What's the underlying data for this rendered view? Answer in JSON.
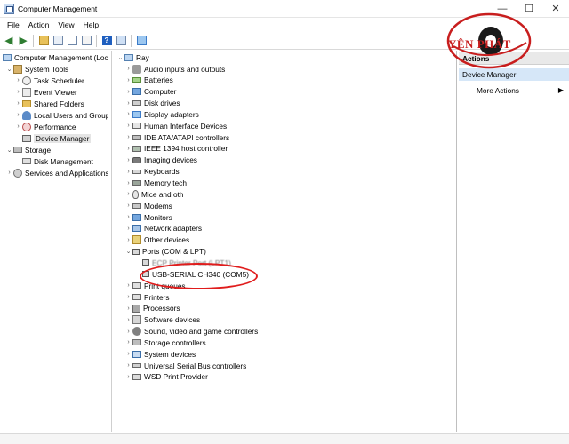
{
  "window": {
    "title": "Computer Management",
    "minimize": "—",
    "maximize": "☐",
    "close": "✕"
  },
  "menu": [
    "File",
    "Action",
    "View",
    "Help"
  ],
  "toolbar": {
    "icons": [
      "back-arrow-icon",
      "forward-arrow-icon",
      "up-folder-icon",
      "show-hide-tree-icon",
      "properties-icon",
      "refresh-icon",
      "help-icon",
      "show-hide-action-pane-icon",
      "computer-icon"
    ]
  },
  "tree": {
    "root": "Computer Management (Local",
    "system_tools": "System Tools",
    "task_scheduler": "Task Scheduler",
    "event_viewer": "Event Viewer",
    "shared_folders": "Shared Folders",
    "local_users": "Local Users and Groups",
    "performance": "Performance",
    "device_manager": "Device Manager",
    "storage": "Storage",
    "disk_management": "Disk Management",
    "services": "Services and Applications"
  },
  "devices": {
    "root": "Ray",
    "categories": [
      {
        "label": "Audio inputs and outputs",
        "icon": "audio"
      },
      {
        "label": "Batteries",
        "icon": "battery"
      },
      {
        "label": "Computer",
        "icon": "monitor"
      },
      {
        "label": "Disk drives",
        "icon": "drive"
      },
      {
        "label": "Display adapters",
        "icon": "display"
      },
      {
        "label": "Human Interface Devices",
        "icon": "hid"
      },
      {
        "label": "IDE ATA/ATAPI controllers",
        "icon": "ide"
      },
      {
        "label": "IEEE 1394 host controller",
        "icon": "ieee"
      },
      {
        "label": "Imaging devices",
        "icon": "camera"
      },
      {
        "label": "Keyboards",
        "icon": "keyboard"
      },
      {
        "label": "Memory tech",
        "icon": "memory"
      },
      {
        "label": "Mice and oth",
        "icon": "mouse"
      },
      {
        "label": "Modems",
        "icon": "modem"
      },
      {
        "label": "Monitors",
        "icon": "monitor"
      },
      {
        "label": "Network adapters",
        "icon": "network"
      },
      {
        "label": "Other devices",
        "icon": "other"
      },
      {
        "label": "Ports (COM & LPT)",
        "icon": "port"
      }
    ],
    "ports_children": [
      "ECP Printer Port (LPT1)",
      "USB-SERIAL CH340 (COM5)"
    ],
    "categories_after": [
      {
        "label": "Print queues",
        "icon": "print"
      },
      {
        "label": "Printers",
        "icon": "print"
      },
      {
        "label": "Processors",
        "icon": "cpu"
      },
      {
        "label": "Software devices",
        "icon": "software"
      },
      {
        "label": "Sound, video and game controllers",
        "icon": "sound"
      },
      {
        "label": "Storage controllers",
        "icon": "storage"
      },
      {
        "label": "System devices",
        "icon": "sys"
      },
      {
        "label": "Universal Serial Bus controllers",
        "icon": "usb"
      },
      {
        "label": "WSD Print Provider",
        "icon": "wsd"
      }
    ]
  },
  "actions": {
    "header": "Actions",
    "section": "Device Manager",
    "more": "More Actions",
    "more_arrow": "▶"
  },
  "watermark": {
    "text": "YÊN PHÁT",
    "color": "#c81e1e"
  },
  "colors": {
    "highlight_circle": "#e01c1c",
    "selection": "#d6e7f8"
  }
}
